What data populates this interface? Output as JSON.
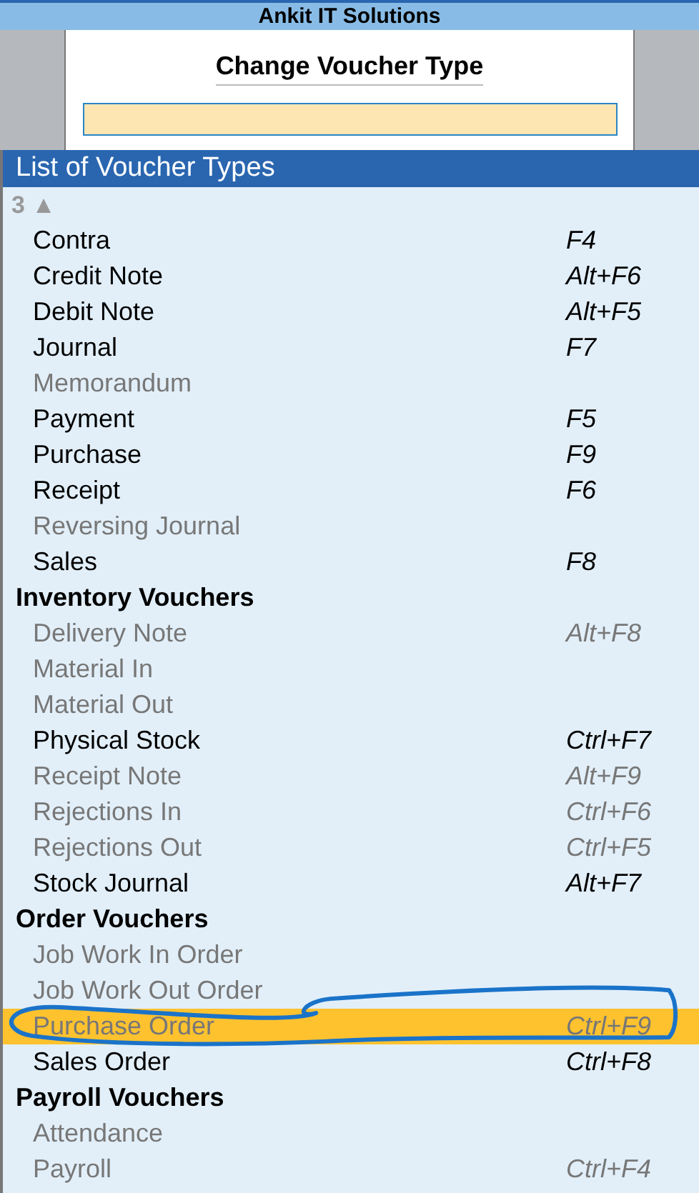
{
  "company": "Ankit IT Solutions",
  "dialog": {
    "title": "Change Voucher Type"
  },
  "list": {
    "title": "List of Voucher Types",
    "scroll_indicator": "3 ▲",
    "rows": [
      {
        "kind": "item",
        "label": "Contra",
        "shortcut": "F4",
        "disabled": false,
        "selected": false
      },
      {
        "kind": "item",
        "label": "Credit Note",
        "shortcut": "Alt+F6",
        "disabled": false,
        "selected": false
      },
      {
        "kind": "item",
        "label": "Debit Note",
        "shortcut": "Alt+F5",
        "disabled": false,
        "selected": false
      },
      {
        "kind": "item",
        "label": "Journal",
        "shortcut": "F7",
        "disabled": false,
        "selected": false
      },
      {
        "kind": "item",
        "label": "Memorandum",
        "disabled": true,
        "selected": false
      },
      {
        "kind": "item",
        "label": "Payment",
        "shortcut": "F5",
        "disabled": false,
        "selected": false
      },
      {
        "kind": "item",
        "label": "Purchase",
        "shortcut": "F9",
        "disabled": false,
        "selected": false
      },
      {
        "kind": "item",
        "label": "Receipt",
        "shortcut": "F6",
        "disabled": false,
        "selected": false
      },
      {
        "kind": "item",
        "label": "Reversing Journal",
        "disabled": true,
        "selected": false
      },
      {
        "kind": "item",
        "label": "Sales",
        "shortcut": "F8",
        "disabled": false,
        "selected": false
      },
      {
        "kind": "group",
        "label": "Inventory Vouchers"
      },
      {
        "kind": "item",
        "label": "Delivery Note",
        "shortcut": "Alt+F8",
        "disabled": true,
        "selected": false
      },
      {
        "kind": "item",
        "label": "Material In",
        "disabled": true,
        "selected": false
      },
      {
        "kind": "item",
        "label": "Material Out",
        "disabled": true,
        "selected": false
      },
      {
        "kind": "item",
        "label": "Physical Stock",
        "shortcut": "Ctrl+F7",
        "disabled": false,
        "selected": false
      },
      {
        "kind": "item",
        "label": "Receipt Note",
        "shortcut": "Alt+F9",
        "disabled": true,
        "selected": false
      },
      {
        "kind": "item",
        "label": "Rejections In",
        "shortcut": "Ctrl+F6",
        "disabled": true,
        "selected": false
      },
      {
        "kind": "item",
        "label": "Rejections Out",
        "shortcut": "Ctrl+F5",
        "disabled": true,
        "selected": false
      },
      {
        "kind": "item",
        "label": "Stock Journal",
        "shortcut": "Alt+F7",
        "disabled": false,
        "selected": false
      },
      {
        "kind": "group",
        "label": "Order Vouchers"
      },
      {
        "kind": "item",
        "label": "Job Work In Order",
        "disabled": true,
        "selected": false
      },
      {
        "kind": "item",
        "label": "Job Work Out Order",
        "disabled": true,
        "selected": false
      },
      {
        "kind": "item",
        "label": "Purchase Order",
        "shortcut": "Ctrl+F9",
        "disabled": true,
        "selected": true
      },
      {
        "kind": "item",
        "label": "Sales Order",
        "shortcut": "Ctrl+F8",
        "disabled": false,
        "selected": false
      },
      {
        "kind": "group",
        "label": "Payroll Vouchers"
      },
      {
        "kind": "item",
        "label": "Attendance",
        "disabled": true,
        "selected": false
      },
      {
        "kind": "item",
        "label": "Payroll",
        "shortcut": "Ctrl+F4",
        "disabled": true,
        "selected": false
      }
    ]
  }
}
